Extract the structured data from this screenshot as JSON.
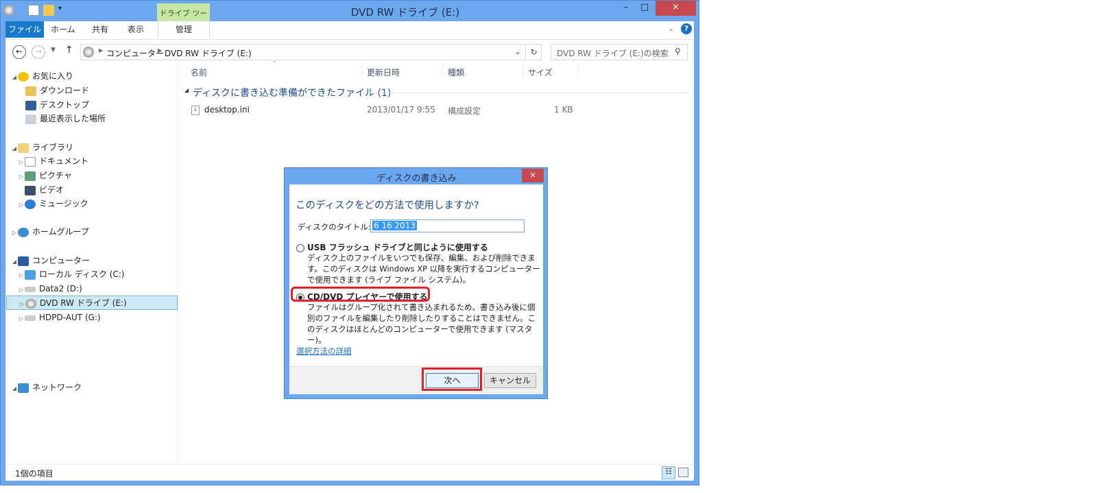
{
  "window": {
    "title": "DVD RW ドライブ (E:)",
    "minimize": "–",
    "maximize": "□",
    "close": "×"
  },
  "ribbon": {
    "context_group": "ドライブ ツール",
    "tabs": [
      {
        "label": "ファイル"
      },
      {
        "label": "ホーム"
      },
      {
        "label": "共有"
      },
      {
        "label": "表示"
      },
      {
        "label": "管理"
      }
    ]
  },
  "address": {
    "breadcrumb": [
      "コンピューター",
      "DVD RW ドライブ (E:)"
    ],
    "search_placeholder": "DVD RW ドライブ (E:)の検索"
  },
  "nav": {
    "favorites": {
      "label": "お気に入り",
      "items": [
        "ダウンロード",
        "デスクトップ",
        "最近表示した場所"
      ]
    },
    "libraries": {
      "label": "ライブラリ",
      "items": [
        "ドキュメント",
        "ピクチャ",
        "ビデオ",
        "ミュージック"
      ]
    },
    "homegroup": {
      "label": "ホームグループ"
    },
    "computer": {
      "label": "コンピューター",
      "items": [
        "ローカル ディスク (C:)",
        "Data2 (D:)",
        "DVD RW ドライブ (E:)",
        "HDPD-AUT (G:)"
      ],
      "selected": "DVD RW ドライブ (E:)"
    },
    "network": {
      "label": "ネットワーク"
    }
  },
  "files": {
    "columns": [
      "名前",
      "更新日時",
      "種類",
      "サイズ"
    ],
    "group_label": "ディスクに書き込む準備ができたファイル (1)",
    "rows": [
      {
        "name": "desktop.ini",
        "modified": "2013/01/17 9:55",
        "type": "構成設定",
        "size": "1 KB"
      }
    ]
  },
  "status": {
    "item_count": "1個の項目"
  },
  "dialog": {
    "title": "ディスクの書き込み",
    "close": "×",
    "heading": "このディスクをどの方法で使用しますか?",
    "disc_title_label": "ディスクのタイトル:",
    "disc_title_value": "6 16 2013",
    "options": [
      {
        "label": "USB フラッシュ ドライブと同じように使用する",
        "description": "ディスク上のファイルをいつでも保存、編集、および削除できます。このディスクは Windows XP 以降を実行するコンピューターで使用できます (ライブ ファイル システム)。",
        "selected": false
      },
      {
        "label": "CD/DVD プレイヤーで使用する",
        "description": "ファイルはグループ化されて書き込まれるため、書き込み後に個別のファイルを編集したり削除したりすることはできません。このディスクはほとんどのコンピューターで使用できます (マスター)。",
        "selected": true
      }
    ],
    "help_link": "選択方法の詳細",
    "next_button": "次へ",
    "cancel_button": "キャンセル"
  },
  "colors": {
    "frame": "#6ca8ee",
    "file_tab": "#1979ca",
    "context_tab": "#c7e8a5",
    "close": "#c7484f",
    "highlight": "#e3202a",
    "selection": "#cce8f4",
    "heading": "#1e4e8c"
  }
}
